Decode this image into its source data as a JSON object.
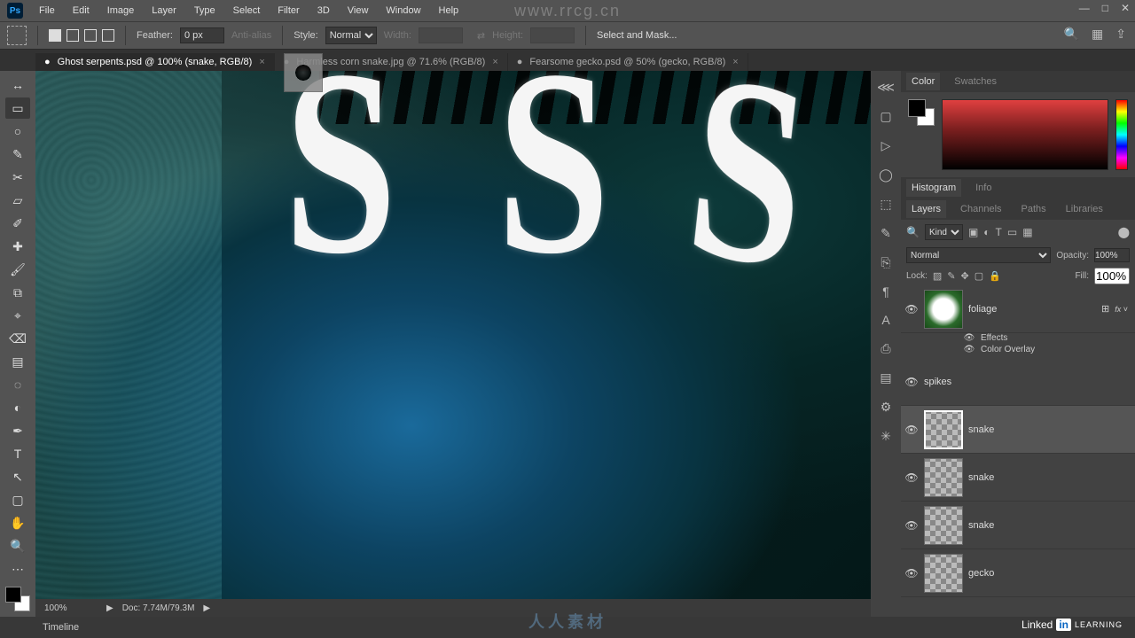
{
  "app": {
    "logo": "Ps"
  },
  "menu": [
    "File",
    "Edit",
    "Image",
    "Layer",
    "Type",
    "Select",
    "Filter",
    "3D",
    "View",
    "Window",
    "Help"
  ],
  "window_controls": {
    "min": "—",
    "max": "□",
    "close": "✕"
  },
  "options": {
    "feather_label": "Feather:",
    "feather_value": "0 px",
    "antialias": "Anti-alias",
    "style_label": "Style:",
    "style_value": "Normal",
    "width_label": "Width:",
    "height_label": "Height:",
    "select_mask": "Select and Mask...",
    "search": "🔍",
    "frames": "▦",
    "share": "⇪"
  },
  "tabs": [
    {
      "title": "Ghost serpents.psd @ 100% (snake, RGB/8)",
      "active": true,
      "dirty": "●"
    },
    {
      "title": "Harmless corn snake.jpg @ 71.6% (RGB/8)",
      "active": false,
      "dirty": "●"
    },
    {
      "title": "Fearsome gecko.psd @ 50% (gecko, RGB/8)",
      "active": false,
      "dirty": "●"
    }
  ],
  "tools": [
    {
      "g": "↔",
      "n": "move"
    },
    {
      "g": "▭",
      "n": "marquee",
      "active": true
    },
    {
      "g": "○",
      "n": "lasso"
    },
    {
      "g": "✎",
      "n": "quick-select"
    },
    {
      "g": "✂",
      "n": "crop"
    },
    {
      "g": "▱",
      "n": "frame"
    },
    {
      "g": "✐",
      "n": "eyedropper"
    },
    {
      "g": "✚",
      "n": "healing"
    },
    {
      "g": "🖌",
      "n": "brush"
    },
    {
      "g": "⧉",
      "n": "stamp"
    },
    {
      "g": "⌖",
      "n": "history-brush"
    },
    {
      "g": "⌫",
      "n": "eraser"
    },
    {
      "g": "▤",
      "n": "gradient"
    },
    {
      "g": "◌",
      "n": "blur"
    },
    {
      "g": "◐",
      "n": "dodge"
    },
    {
      "g": "✒",
      "n": "pen"
    },
    {
      "g": "T",
      "n": "type"
    },
    {
      "g": "↖",
      "n": "path-select"
    },
    {
      "g": "▢",
      "n": "rectangle"
    },
    {
      "g": "✋",
      "n": "hand"
    },
    {
      "g": "🔍",
      "n": "zoom"
    },
    {
      "g": "⋯",
      "n": "more"
    }
  ],
  "ministrip": [
    "⋘",
    "▢",
    "▷",
    "◯",
    "⬚",
    "✎",
    "⎘",
    "¶",
    "A",
    "⎙",
    "▤",
    "⚙",
    "✳"
  ],
  "status": {
    "zoom": "100%",
    "doc": "Doc: 7.74M/79.3M",
    "arrow": "▶"
  },
  "panels": {
    "color": {
      "tabs": [
        "Color",
        "Swatches"
      ]
    },
    "hist": {
      "tabs": [
        "Histogram",
        "Info"
      ]
    },
    "layers": {
      "tabs": [
        "Layers",
        "Channels",
        "Paths",
        "Libraries"
      ],
      "filter": "Kind",
      "blend": "Normal",
      "opacity_label": "Opacity:",
      "opacity_value": "100%",
      "lock_label": "Lock:",
      "fill_label": "Fill:",
      "fill_value": "100%",
      "effects_label": "Effects",
      "color_overlay": "Color Overlay",
      "fx": "fx",
      "items": [
        {
          "name": "foliage",
          "thumb": "foliage",
          "fx": true
        },
        {
          "name": "spikes",
          "thumb": "spikes"
        },
        {
          "name": "snake",
          "thumb": "checker",
          "selected": true
        },
        {
          "name": "snake",
          "thumb": "checker"
        },
        {
          "name": "snake",
          "thumb": "checker"
        },
        {
          "name": "gecko",
          "thumb": "checker"
        }
      ]
    }
  },
  "timeline": {
    "label": "Timeline"
  },
  "watermarks": {
    "top": "www.rrcg.cn",
    "bottom": "人人素材",
    "linkedin": "Linked",
    "in": "in",
    "learning": "LEARNING"
  }
}
